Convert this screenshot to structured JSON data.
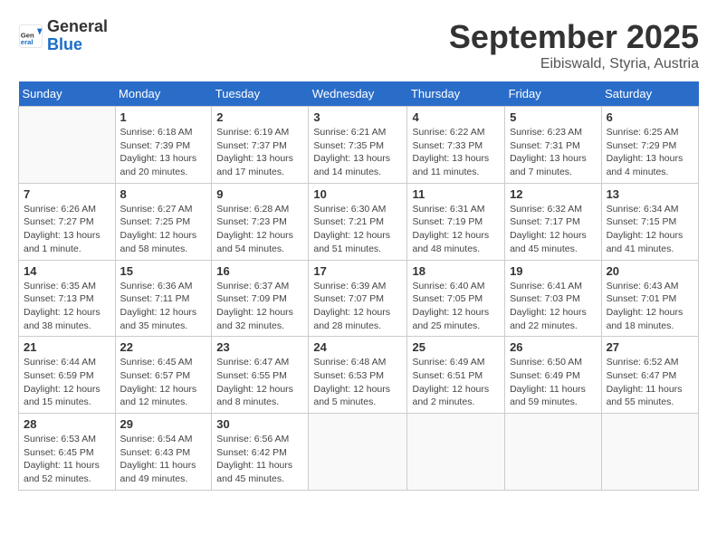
{
  "logo": {
    "general": "General",
    "blue": "Blue"
  },
  "header": {
    "month": "September 2025",
    "location": "Eibiswald, Styria, Austria"
  },
  "weekdays": [
    "Sunday",
    "Monday",
    "Tuesday",
    "Wednesday",
    "Thursday",
    "Friday",
    "Saturday"
  ],
  "weeks": [
    [
      {
        "day": "",
        "info": ""
      },
      {
        "day": "1",
        "info": "Sunrise: 6:18 AM\nSunset: 7:39 PM\nDaylight: 13 hours\nand 20 minutes."
      },
      {
        "day": "2",
        "info": "Sunrise: 6:19 AM\nSunset: 7:37 PM\nDaylight: 13 hours\nand 17 minutes."
      },
      {
        "day": "3",
        "info": "Sunrise: 6:21 AM\nSunset: 7:35 PM\nDaylight: 13 hours\nand 14 minutes."
      },
      {
        "day": "4",
        "info": "Sunrise: 6:22 AM\nSunset: 7:33 PM\nDaylight: 13 hours\nand 11 minutes."
      },
      {
        "day": "5",
        "info": "Sunrise: 6:23 AM\nSunset: 7:31 PM\nDaylight: 13 hours\nand 7 minutes."
      },
      {
        "day": "6",
        "info": "Sunrise: 6:25 AM\nSunset: 7:29 PM\nDaylight: 13 hours\nand 4 minutes."
      }
    ],
    [
      {
        "day": "7",
        "info": "Sunrise: 6:26 AM\nSunset: 7:27 PM\nDaylight: 13 hours\nand 1 minute."
      },
      {
        "day": "8",
        "info": "Sunrise: 6:27 AM\nSunset: 7:25 PM\nDaylight: 12 hours\nand 58 minutes."
      },
      {
        "day": "9",
        "info": "Sunrise: 6:28 AM\nSunset: 7:23 PM\nDaylight: 12 hours\nand 54 minutes."
      },
      {
        "day": "10",
        "info": "Sunrise: 6:30 AM\nSunset: 7:21 PM\nDaylight: 12 hours\nand 51 minutes."
      },
      {
        "day": "11",
        "info": "Sunrise: 6:31 AM\nSunset: 7:19 PM\nDaylight: 12 hours\nand 48 minutes."
      },
      {
        "day": "12",
        "info": "Sunrise: 6:32 AM\nSunset: 7:17 PM\nDaylight: 12 hours\nand 45 minutes."
      },
      {
        "day": "13",
        "info": "Sunrise: 6:34 AM\nSunset: 7:15 PM\nDaylight: 12 hours\nand 41 minutes."
      }
    ],
    [
      {
        "day": "14",
        "info": "Sunrise: 6:35 AM\nSunset: 7:13 PM\nDaylight: 12 hours\nand 38 minutes."
      },
      {
        "day": "15",
        "info": "Sunrise: 6:36 AM\nSunset: 7:11 PM\nDaylight: 12 hours\nand 35 minutes."
      },
      {
        "day": "16",
        "info": "Sunrise: 6:37 AM\nSunset: 7:09 PM\nDaylight: 12 hours\nand 32 minutes."
      },
      {
        "day": "17",
        "info": "Sunrise: 6:39 AM\nSunset: 7:07 PM\nDaylight: 12 hours\nand 28 minutes."
      },
      {
        "day": "18",
        "info": "Sunrise: 6:40 AM\nSunset: 7:05 PM\nDaylight: 12 hours\nand 25 minutes."
      },
      {
        "day": "19",
        "info": "Sunrise: 6:41 AM\nSunset: 7:03 PM\nDaylight: 12 hours\nand 22 minutes."
      },
      {
        "day": "20",
        "info": "Sunrise: 6:43 AM\nSunset: 7:01 PM\nDaylight: 12 hours\nand 18 minutes."
      }
    ],
    [
      {
        "day": "21",
        "info": "Sunrise: 6:44 AM\nSunset: 6:59 PM\nDaylight: 12 hours\nand 15 minutes."
      },
      {
        "day": "22",
        "info": "Sunrise: 6:45 AM\nSunset: 6:57 PM\nDaylight: 12 hours\nand 12 minutes."
      },
      {
        "day": "23",
        "info": "Sunrise: 6:47 AM\nSunset: 6:55 PM\nDaylight: 12 hours\nand 8 minutes."
      },
      {
        "day": "24",
        "info": "Sunrise: 6:48 AM\nSunset: 6:53 PM\nDaylight: 12 hours\nand 5 minutes."
      },
      {
        "day": "25",
        "info": "Sunrise: 6:49 AM\nSunset: 6:51 PM\nDaylight: 12 hours\nand 2 minutes."
      },
      {
        "day": "26",
        "info": "Sunrise: 6:50 AM\nSunset: 6:49 PM\nDaylight: 11 hours\nand 59 minutes."
      },
      {
        "day": "27",
        "info": "Sunrise: 6:52 AM\nSunset: 6:47 PM\nDaylight: 11 hours\nand 55 minutes."
      }
    ],
    [
      {
        "day": "28",
        "info": "Sunrise: 6:53 AM\nSunset: 6:45 PM\nDaylight: 11 hours\nand 52 minutes."
      },
      {
        "day": "29",
        "info": "Sunrise: 6:54 AM\nSunset: 6:43 PM\nDaylight: 11 hours\nand 49 minutes."
      },
      {
        "day": "30",
        "info": "Sunrise: 6:56 AM\nSunset: 6:42 PM\nDaylight: 11 hours\nand 45 minutes."
      },
      {
        "day": "",
        "info": ""
      },
      {
        "day": "",
        "info": ""
      },
      {
        "day": "",
        "info": ""
      },
      {
        "day": "",
        "info": ""
      }
    ]
  ]
}
